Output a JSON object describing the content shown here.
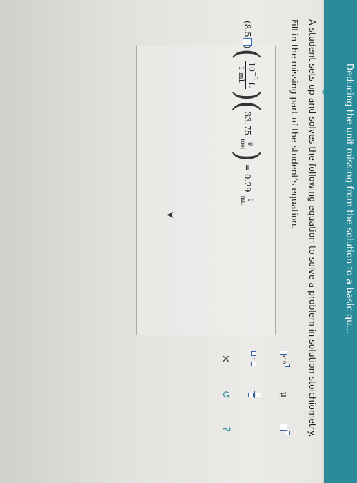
{
  "header": {
    "title": "Deducing the unit missing from the solution to a basic qu..."
  },
  "prompt": {
    "line1": "A student sets up and solves the following equation to solve a problem in solution stoichiometry.",
    "line2": "Fill in the missing part of the student's equation."
  },
  "equation": {
    "term1_value": "(8.5",
    "frac1_num_base": "10",
    "frac1_num_exp": "−3",
    "frac1_num_unit": "L",
    "frac1_den": "1 mL",
    "term3_value": "33.75",
    "frac3_num": "g",
    "frac3_den": "mol",
    "equals": "=",
    "result_value": "0.29",
    "result_num": "g",
    "result_den": "mL"
  },
  "toolbar": {
    "tool_superscript_sub": "x10",
    "tool_mu": "μ",
    "tool_dot": "·",
    "close_label": "×",
    "undo_label": "↺",
    "help_label": "?"
  },
  "colors": {
    "accent": "#2a8c9b",
    "input_border": "#3b6fd0"
  }
}
